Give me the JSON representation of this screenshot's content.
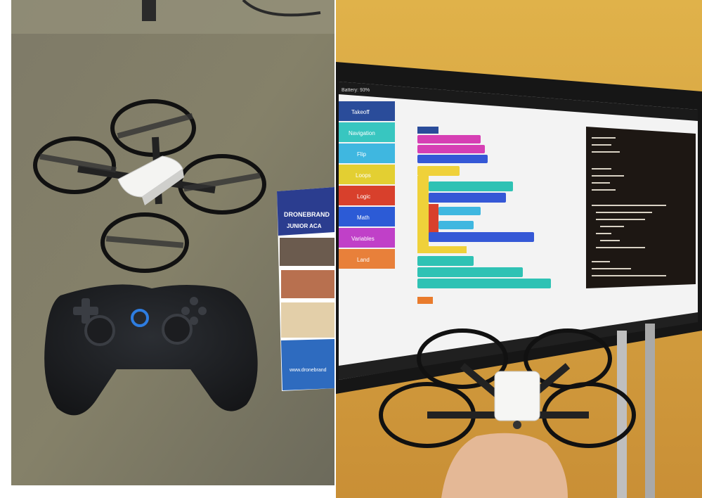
{
  "left_photo": {
    "flyer": {
      "brand": "DRONEBRAND",
      "subtitle": "JUNIOR ACA",
      "url": "www.dronebrand"
    }
  },
  "right_photo": {
    "screen": {
      "status": "Battery: 93%",
      "categories": [
        {
          "label": "Takeoff",
          "color": "#2a4c9a"
        },
        {
          "label": "Navigation",
          "color": "#38c6c0"
        },
        {
          "label": "Flip",
          "color": "#3fb7e0"
        },
        {
          "label": "Loops",
          "color": "#e3cf32"
        },
        {
          "label": "Logic",
          "color": "#d8402c"
        },
        {
          "label": "Math",
          "color": "#2c5bd6"
        },
        {
          "label": "Variables",
          "color": "#c040c8"
        },
        {
          "label": "Land",
          "color": "#e8803a"
        }
      ],
      "colors": {
        "block_pink": "#d63fb4",
        "block_blue": "#3558d6",
        "block_yellow": "#efd13a",
        "block_teal": "#2fc2b4",
        "block_orange": "#e97b2c",
        "code_bg": "#1d1713"
      }
    }
  }
}
